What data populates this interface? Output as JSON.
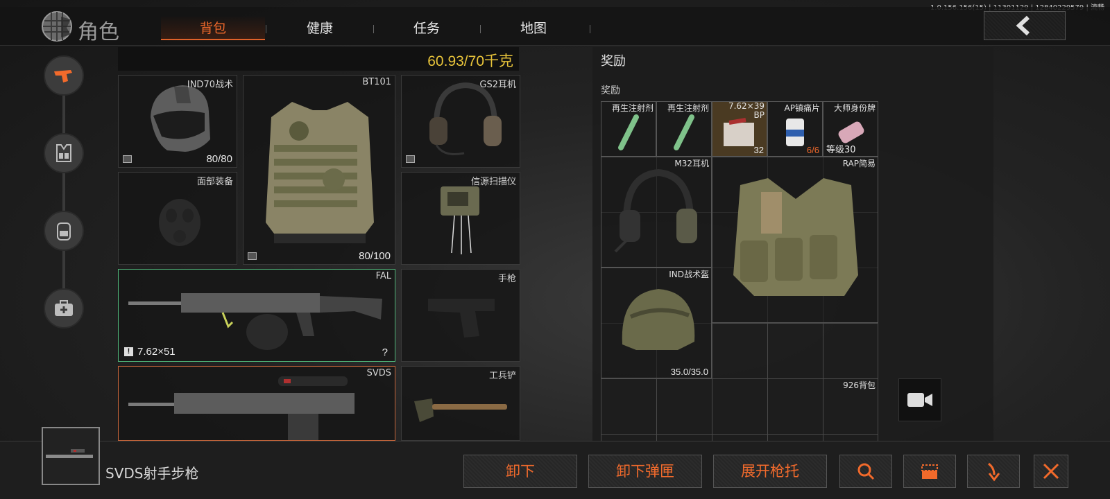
{
  "version": "1.0.156.156(15) | 11301129 | 12840229579 | 流畅",
  "header": {
    "title": "角色",
    "tabs": [
      {
        "label": "背包",
        "active": true
      },
      {
        "label": "健康",
        "active": false
      },
      {
        "label": "任务",
        "active": false
      },
      {
        "label": "地图",
        "active": false
      }
    ],
    "back_icon": "chevron-left-icon"
  },
  "side_nav": [
    "gun-icon",
    "rig-icon",
    "backpack-icon",
    "medkit-icon"
  ],
  "weight": "60.93/70千克",
  "slots": {
    "helmet": {
      "name": "IND70战术",
      "durability": "80/80"
    },
    "armor": {
      "name": "BT101",
      "durability": "80/100"
    },
    "headset": {
      "name": "GS2耳机"
    },
    "face": {
      "name": "面部装备"
    },
    "scanner": {
      "name": "信源扫描仪"
    },
    "primary": {
      "name": "FAL",
      "ammo": "7.62×51",
      "ammo_count": "?"
    },
    "pistol": {
      "name": "手枪"
    },
    "secondary": {
      "name": "SVDS"
    },
    "melee": {
      "name": "工兵铲"
    }
  },
  "reward": {
    "title": "奖励",
    "subtitle": "奖励",
    "items": [
      {
        "name": "再生注射剂"
      },
      {
        "name": "再生注射剂"
      },
      {
        "name": "7.62×39",
        "name2": "BP",
        "count": "32"
      },
      {
        "name": "AP镇痛片",
        "count": "6/6"
      },
      {
        "name": "大师身份牌",
        "level": "等级30"
      },
      {
        "name": "M32耳机"
      },
      {
        "name": "RAP简易"
      },
      {
        "name": "IND战术盔",
        "count": "35.0/35.0"
      },
      {
        "name": "926背包"
      }
    ]
  },
  "selected": {
    "name": "SVDS射手步枪"
  },
  "actions": {
    "unload": "卸下",
    "unload_mag": "卸下弹匣",
    "unfold_stock": "展开枪托"
  },
  "icons": {
    "search": "search-icon",
    "inspect": "inspect-icon",
    "drop": "drop-arrow-icon",
    "close": "close-icon",
    "video": "video-camera-icon"
  },
  "colors": {
    "accent": "#f26a2b",
    "weight": "#e7c33a",
    "primary_border": "#4fb77a",
    "secondary_border": "#c8663a"
  }
}
